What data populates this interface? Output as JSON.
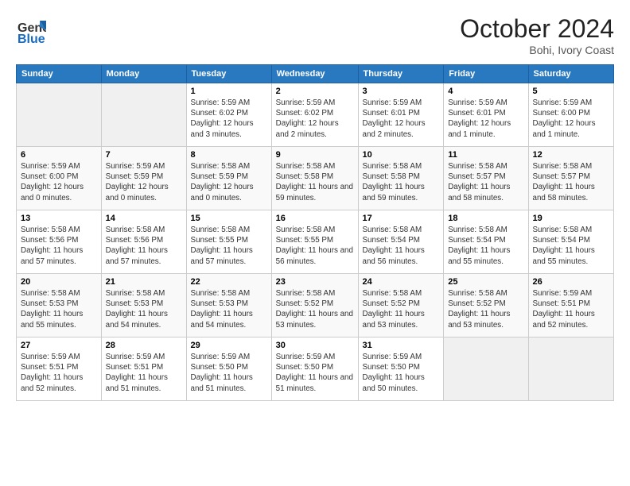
{
  "header": {
    "logo_general": "General",
    "logo_blue": "Blue",
    "month_title": "October 2024",
    "location": "Bohi, Ivory Coast"
  },
  "weekdays": [
    "Sunday",
    "Monday",
    "Tuesday",
    "Wednesday",
    "Thursday",
    "Friday",
    "Saturday"
  ],
  "weeks": [
    [
      {
        "day": "",
        "info": ""
      },
      {
        "day": "",
        "info": ""
      },
      {
        "day": "1",
        "info": "Sunrise: 5:59 AM\nSunset: 6:02 PM\nDaylight: 12 hours and 3 minutes."
      },
      {
        "day": "2",
        "info": "Sunrise: 5:59 AM\nSunset: 6:02 PM\nDaylight: 12 hours and 2 minutes."
      },
      {
        "day": "3",
        "info": "Sunrise: 5:59 AM\nSunset: 6:01 PM\nDaylight: 12 hours and 2 minutes."
      },
      {
        "day": "4",
        "info": "Sunrise: 5:59 AM\nSunset: 6:01 PM\nDaylight: 12 hours and 1 minute."
      },
      {
        "day": "5",
        "info": "Sunrise: 5:59 AM\nSunset: 6:00 PM\nDaylight: 12 hours and 1 minute."
      }
    ],
    [
      {
        "day": "6",
        "info": "Sunrise: 5:59 AM\nSunset: 6:00 PM\nDaylight: 12 hours and 0 minutes."
      },
      {
        "day": "7",
        "info": "Sunrise: 5:59 AM\nSunset: 5:59 PM\nDaylight: 12 hours and 0 minutes."
      },
      {
        "day": "8",
        "info": "Sunrise: 5:58 AM\nSunset: 5:59 PM\nDaylight: 12 hours and 0 minutes."
      },
      {
        "day": "9",
        "info": "Sunrise: 5:58 AM\nSunset: 5:58 PM\nDaylight: 11 hours and 59 minutes."
      },
      {
        "day": "10",
        "info": "Sunrise: 5:58 AM\nSunset: 5:58 PM\nDaylight: 11 hours and 59 minutes."
      },
      {
        "day": "11",
        "info": "Sunrise: 5:58 AM\nSunset: 5:57 PM\nDaylight: 11 hours and 58 minutes."
      },
      {
        "day": "12",
        "info": "Sunrise: 5:58 AM\nSunset: 5:57 PM\nDaylight: 11 hours and 58 minutes."
      }
    ],
    [
      {
        "day": "13",
        "info": "Sunrise: 5:58 AM\nSunset: 5:56 PM\nDaylight: 11 hours and 57 minutes."
      },
      {
        "day": "14",
        "info": "Sunrise: 5:58 AM\nSunset: 5:56 PM\nDaylight: 11 hours and 57 minutes."
      },
      {
        "day": "15",
        "info": "Sunrise: 5:58 AM\nSunset: 5:55 PM\nDaylight: 11 hours and 57 minutes."
      },
      {
        "day": "16",
        "info": "Sunrise: 5:58 AM\nSunset: 5:55 PM\nDaylight: 11 hours and 56 minutes."
      },
      {
        "day": "17",
        "info": "Sunrise: 5:58 AM\nSunset: 5:54 PM\nDaylight: 11 hours and 56 minutes."
      },
      {
        "day": "18",
        "info": "Sunrise: 5:58 AM\nSunset: 5:54 PM\nDaylight: 11 hours and 55 minutes."
      },
      {
        "day": "19",
        "info": "Sunrise: 5:58 AM\nSunset: 5:54 PM\nDaylight: 11 hours and 55 minutes."
      }
    ],
    [
      {
        "day": "20",
        "info": "Sunrise: 5:58 AM\nSunset: 5:53 PM\nDaylight: 11 hours and 55 minutes."
      },
      {
        "day": "21",
        "info": "Sunrise: 5:58 AM\nSunset: 5:53 PM\nDaylight: 11 hours and 54 minutes."
      },
      {
        "day": "22",
        "info": "Sunrise: 5:58 AM\nSunset: 5:53 PM\nDaylight: 11 hours and 54 minutes."
      },
      {
        "day": "23",
        "info": "Sunrise: 5:58 AM\nSunset: 5:52 PM\nDaylight: 11 hours and 53 minutes."
      },
      {
        "day": "24",
        "info": "Sunrise: 5:58 AM\nSunset: 5:52 PM\nDaylight: 11 hours and 53 minutes."
      },
      {
        "day": "25",
        "info": "Sunrise: 5:58 AM\nSunset: 5:52 PM\nDaylight: 11 hours and 53 minutes."
      },
      {
        "day": "26",
        "info": "Sunrise: 5:59 AM\nSunset: 5:51 PM\nDaylight: 11 hours and 52 minutes."
      }
    ],
    [
      {
        "day": "27",
        "info": "Sunrise: 5:59 AM\nSunset: 5:51 PM\nDaylight: 11 hours and 52 minutes."
      },
      {
        "day": "28",
        "info": "Sunrise: 5:59 AM\nSunset: 5:51 PM\nDaylight: 11 hours and 51 minutes."
      },
      {
        "day": "29",
        "info": "Sunrise: 5:59 AM\nSunset: 5:50 PM\nDaylight: 11 hours and 51 minutes."
      },
      {
        "day": "30",
        "info": "Sunrise: 5:59 AM\nSunset: 5:50 PM\nDaylight: 11 hours and 51 minutes."
      },
      {
        "day": "31",
        "info": "Sunrise: 5:59 AM\nSunset: 5:50 PM\nDaylight: 11 hours and 50 minutes."
      },
      {
        "day": "",
        "info": ""
      },
      {
        "day": "",
        "info": ""
      }
    ]
  ]
}
